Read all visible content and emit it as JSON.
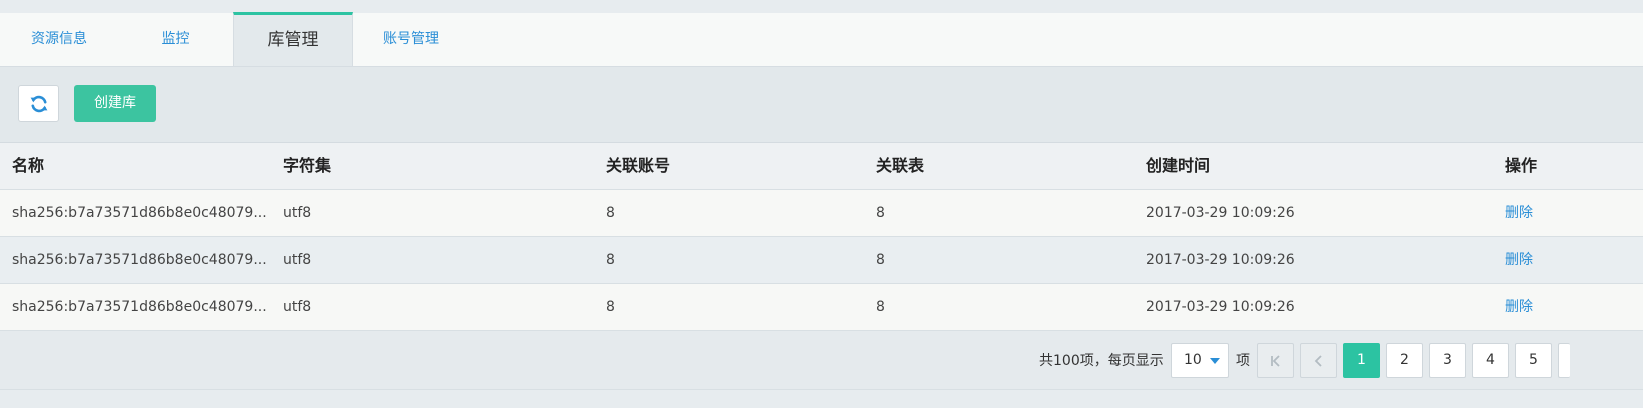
{
  "tabs": [
    {
      "label": "资源信息"
    },
    {
      "label": "监控"
    },
    {
      "label": "库管理"
    },
    {
      "label": "账号管理"
    }
  ],
  "toolbar": {
    "refresh_icon": "refresh-icon",
    "create_label": "创建库"
  },
  "table": {
    "headers": [
      "名称",
      "字符集",
      "关联账号",
      "关联表",
      "创建时间",
      "操作"
    ],
    "rows": [
      {
        "name": "sha256:b7a73571d86b8e0c48079...",
        "charset": "utf8",
        "accounts": "8",
        "tables": "8",
        "created": "2017-03-29 10:09:26",
        "action": "删除"
      },
      {
        "name": "sha256:b7a73571d86b8e0c48079...",
        "charset": "utf8",
        "accounts": "8",
        "tables": "8",
        "created": "2017-03-29 10:09:26",
        "action": "删除"
      },
      {
        "name": "sha256:b7a73571d86b8e0c48079...",
        "charset": "utf8",
        "accounts": "8",
        "tables": "8",
        "created": "2017-03-29 10:09:26",
        "action": "删除"
      }
    ]
  },
  "pagination": {
    "total_text": "共100项，每页显示",
    "page_size": "10",
    "unit_text": "项",
    "first_icon": "first-page-icon",
    "prev_icon": "prev-page-icon",
    "pages": [
      "1",
      "2",
      "3",
      "4",
      "5"
    ],
    "current_page": "1"
  },
  "colors": {
    "accent": "#2cc3a2",
    "link": "#2a8ed6"
  }
}
